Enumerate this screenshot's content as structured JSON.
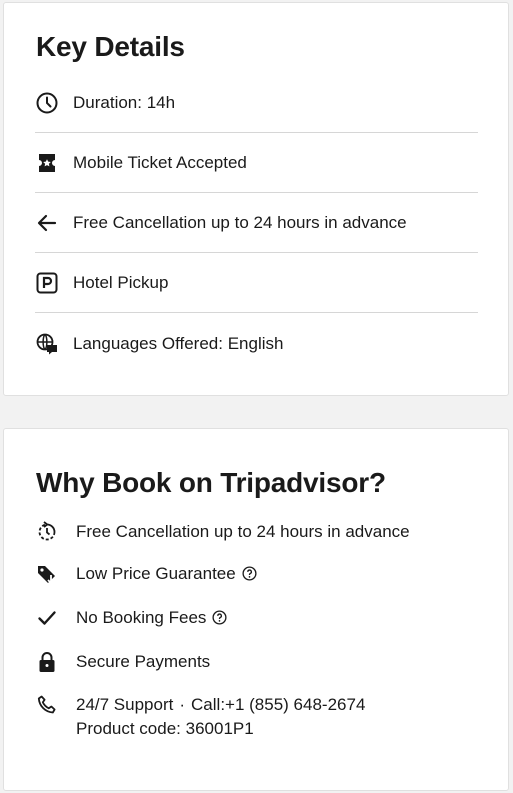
{
  "key_details": {
    "title": "Key Details",
    "items": [
      {
        "icon": "clock-icon",
        "label": "Duration: 14h"
      },
      {
        "icon": "ticket-icon",
        "label": "Mobile Ticket Accepted"
      },
      {
        "icon": "arrow-left-icon",
        "label": "Free Cancellation up to 24 hours in advance"
      },
      {
        "icon": "parking-icon",
        "label": "Hotel Pickup"
      },
      {
        "icon": "globe-chat-icon",
        "label": "Languages Offered: English"
      }
    ]
  },
  "why_book": {
    "title": "Why Book on Tripadvisor?",
    "items": [
      {
        "icon": "refresh-clock-icon",
        "label": "Free Cancellation up to 24 hours in advance"
      },
      {
        "icon": "price-tag-icon",
        "label": "Low Price Guarantee"
      },
      {
        "icon": "checkmark-icon",
        "label": "No Booking Fees"
      },
      {
        "icon": "lock-icon",
        "label": "Secure Payments"
      }
    ],
    "support": {
      "icon": "phone-icon",
      "label": "24/7 Support",
      "separator": "·",
      "call": "Call:+1 (855) 648-2674",
      "product_code": "Product code: 36001P1"
    }
  },
  "colors": {
    "text": "#1a1a1a",
    "divider": "#d6d6d6",
    "background": "#f2f2f2",
    "card": "#ffffff"
  }
}
